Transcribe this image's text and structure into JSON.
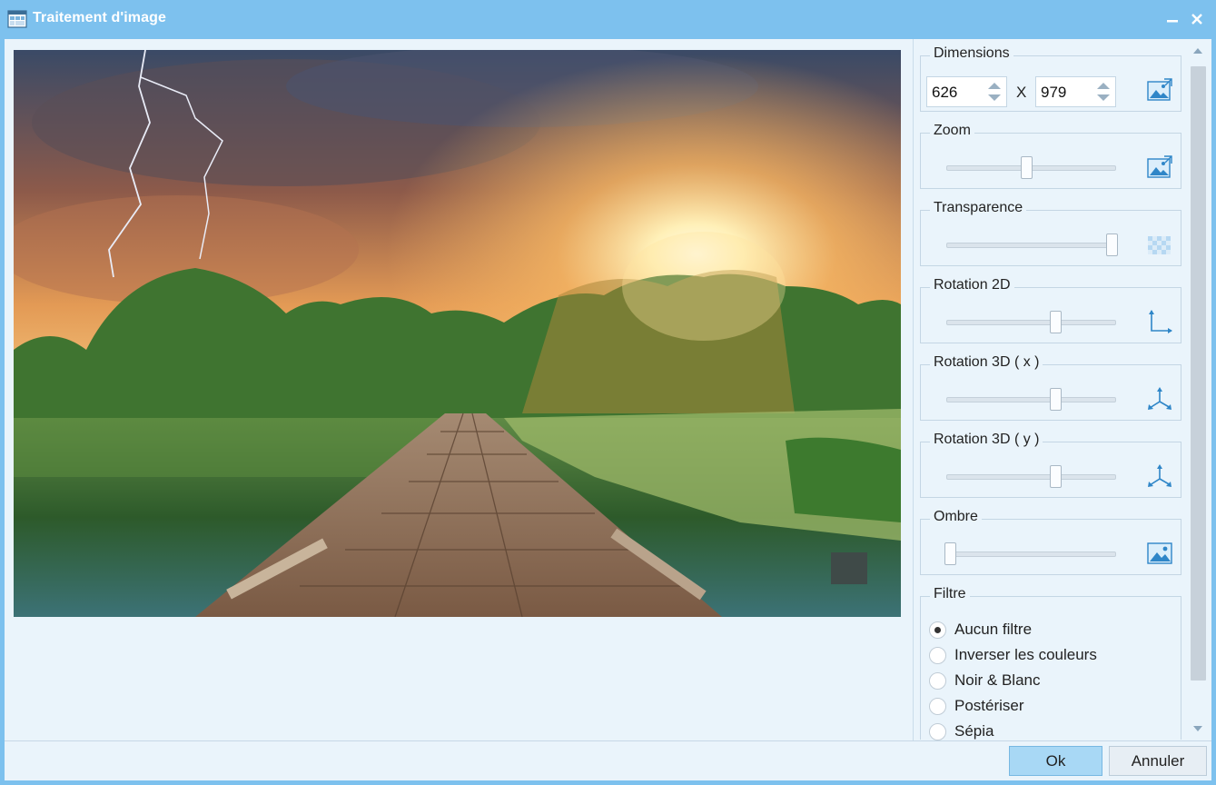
{
  "window": {
    "title": "Traitement d'image"
  },
  "dimensions": {
    "label": "Dimensions",
    "width": "626",
    "height": "979",
    "separator": "X"
  },
  "zoom": {
    "label": "Zoom",
    "value": 0.47
  },
  "transparence": {
    "label": "Transparence",
    "value": 1.0
  },
  "rotation2d": {
    "label": "Rotation 2D",
    "value": 0.65
  },
  "rotation3dx": {
    "label": "Rotation 3D ( x )",
    "value": 0.65
  },
  "rotation3dy": {
    "label": "Rotation 3D ( y )",
    "value": 0.65
  },
  "ombre": {
    "label": "Ombre",
    "value": 0.0
  },
  "filtre": {
    "label": "Filtre",
    "options": [
      "Aucun filtre",
      "Inverser les couleurs",
      "Noir & Blanc",
      "Postériser",
      "Sépia"
    ],
    "selected": "Aucun filtre"
  },
  "footer": {
    "ok_label": "Ok",
    "cancel_label": "Annuler"
  },
  "icons": {
    "app": "image-processing-icon",
    "minimize": "minimize-icon",
    "close": "close-icon",
    "resize": "image-resize-icon",
    "zoom": "image-zoom-icon",
    "transparency": "checkerboard-icon",
    "rotation2d": "axes-2d-icon",
    "rotation3d": "axes-3d-icon",
    "shadow": "image-icon"
  },
  "colors": {
    "titlebar": "#7dc1ee",
    "client": "#eaf4fb",
    "accent": "#2f86c8",
    "ok_button": "#a8d8f5"
  }
}
